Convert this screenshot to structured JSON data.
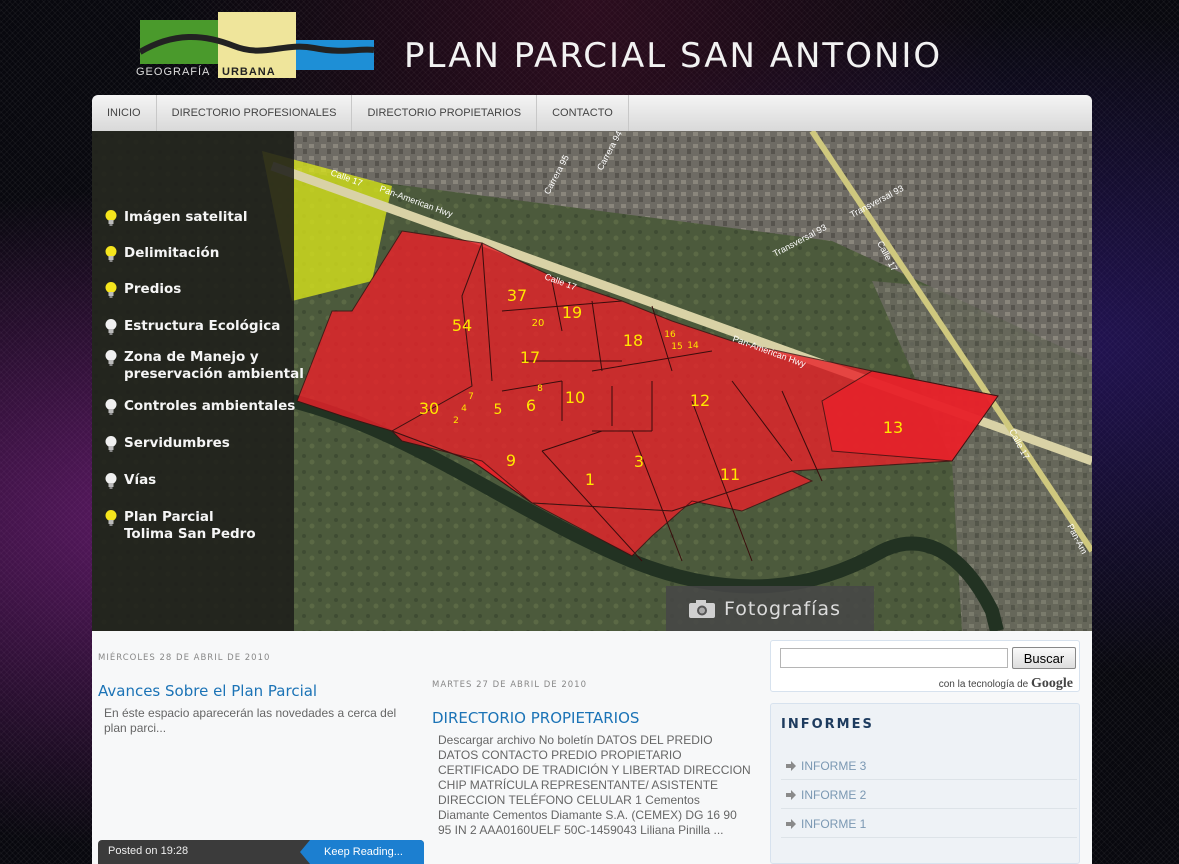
{
  "header": {
    "logo_word1": "GEOGRAFÍA",
    "logo_word2": "URBANA",
    "site_title": "PLAN PARCIAL SAN ANTONIO"
  },
  "nav": {
    "items": [
      "INICIO",
      "DIRECTORIO PROFESIONALES",
      "DIRECTORIO PROPIETARIOS",
      "CONTACTO"
    ]
  },
  "banner": {
    "menu": [
      {
        "label": "Imágen satelital",
        "bulb": "yellow"
      },
      {
        "label": "Delimitación",
        "bulb": "yellow"
      },
      {
        "label": "Predios",
        "bulb": "yellow"
      },
      {
        "label": "Estructura Ecológica",
        "bulb": "white"
      },
      {
        "label": "Zona de Manejo y\npreservación ambiental",
        "bulb": "white"
      },
      {
        "label": "Controles ambientales",
        "bulb": "white"
      },
      {
        "label": "Servidumbres",
        "bulb": "white"
      },
      {
        "label": "Vías",
        "bulb": "white"
      },
      {
        "label": "Plan Parcial\nTolima San Pedro",
        "bulb": "yellow"
      }
    ],
    "map_roads": [
      "Calle 17",
      "Pan-American Hwy",
      "Calle 17",
      "Pan-American Hwy",
      "Carrera 95",
      "Carrera 94",
      "Transversal 93",
      "Transversal 93",
      "Calle 17",
      "Calle 17",
      "Pan-Am"
    ],
    "parcels": [
      "54",
      "37",
      "20",
      "19",
      "17",
      "18",
      "16",
      "15",
      "14",
      "30",
      "7",
      "4",
      "2",
      "5",
      "6",
      "8",
      "10",
      "12",
      "13",
      "9",
      "1",
      "3",
      "11"
    ],
    "photos_label": "Fotografías",
    "colors": {
      "parcel_fill": "#e8222a",
      "yellow_zone": "#d6e21c",
      "map_base": "#3c4a34"
    }
  },
  "posts": [
    {
      "date": "miércoles 28 de abril de 2010",
      "title": "Avances Sobre el Plan Parcial",
      "body": "En éste espacio aparecerán las novedades a cerca del plan parci...",
      "posted": "Posted on 19:28",
      "more": "Keep Reading..."
    },
    {
      "date": "martes 27 de abril de 2010",
      "title": "DIRECTORIO PROPIETARIOS",
      "body": "Descargar archivo No boletín DATOS DEL PREDIO DATOS CONTACTO PREDIO PROPIETARIO CERTIFICADO DE TRADICIÓN Y LIBERTAD DIRECCION CHIP MATRÍCULA REPRESENTANTE/ ASISTENTE DIRECCION TELÉFONO CELULAR 1 Cementos Diamante Cementos Diamante S.A. (CEMEX) DG 16 90 95 IN 2 AAA0160UELF 50C-1459043 Liliana Pinilla ..."
    }
  ],
  "sidebar": {
    "search_value": "",
    "search_button": "Buscar",
    "powered_by": "con la tecnología de",
    "google": "Google",
    "informes_title": "INFORMES",
    "informes": [
      "INFORME 3",
      "INFORME 2",
      "INFORME 1"
    ]
  }
}
